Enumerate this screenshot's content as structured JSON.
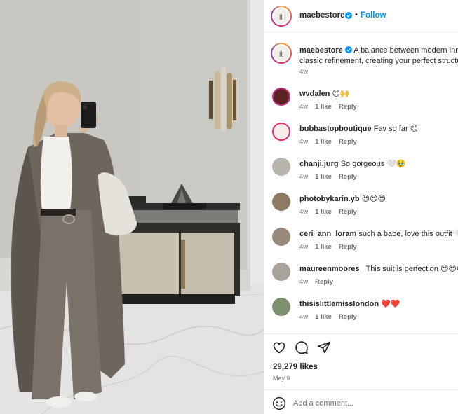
{
  "post": {
    "username": "maebestore",
    "follow_label": "Follow",
    "separator": "•",
    "avatar_text": "|||",
    "caption": "A balance between modern innovation and",
    "caption_line2": "classic refinement, creating your perfect structured",
    "caption_age": "4w",
    "likes": "29,279 likes",
    "date": "May 9",
    "add_comment_placeholder": "Add a comment..."
  },
  "comments": [
    {
      "username": "wvdalen",
      "text": "😍🙌",
      "age": "4w",
      "likes": "1 like",
      "reply": "Reply",
      "avatar_color": "#6a2a2a"
    },
    {
      "username": "bubbastopboutique",
      "text": "Fav so far 😍",
      "age": "4w",
      "likes": "1 like",
      "reply": "Reply",
      "avatar_color": "#f5ece8"
    },
    {
      "username": "chanji.jurg",
      "text": "So gorgeous 🤍🥹",
      "age": "4w",
      "likes": "1 like",
      "reply": "Reply",
      "avatar_color": "#b9b4ac"
    },
    {
      "username": "photobykarin.yb",
      "text": "😍😍😍",
      "age": "4w",
      "likes": "1 like",
      "reply": "Reply",
      "avatar_color": "#8d7a62"
    },
    {
      "username": "ceri_ann_loram",
      "text": "such a babe, love this outfit 🤍",
      "age": "4w",
      "likes": "1 like",
      "reply": "Reply",
      "avatar_color": "#9a8a7c"
    },
    {
      "username": "maureenmoores_",
      "text": "This suit is perfection 😍😍😍",
      "age": "4w",
      "likes": "",
      "reply": "Reply",
      "avatar_color": "#a8a29a"
    },
    {
      "username": "thisislittlemisslondon",
      "text": "❤️❤️",
      "age": "4w",
      "likes": "1 like",
      "reply": "Reply",
      "avatar_color": "#7c8f6e"
    }
  ],
  "icons": {
    "like": "heart-icon",
    "comment": "comment-icon",
    "share": "share-icon",
    "emoji": "emoji-icon",
    "verified": "verified-badge-icon"
  },
  "colors": {
    "accent": "#0095f6",
    "text": "#262626",
    "muted": "#737373"
  }
}
